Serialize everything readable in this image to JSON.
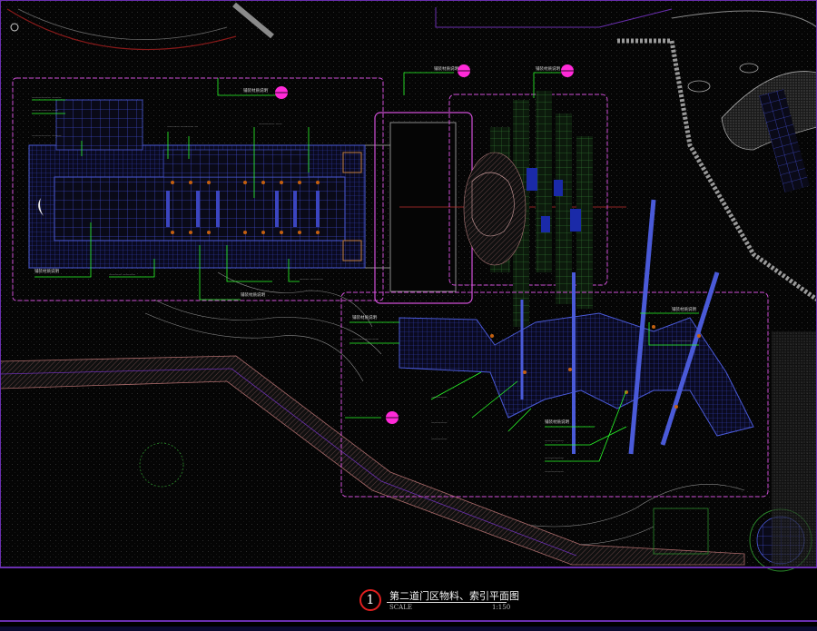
{
  "drawing": {
    "index_number": "1",
    "title": "第二道门区物料、索引平面图",
    "scale_label": "SCALE",
    "scale_value": "1:150"
  },
  "colors": {
    "background": "#000000",
    "frame": "#6a2fb0",
    "zone_outline": "#d04fd8",
    "leader": "#2aff2a",
    "grid": "#4a5ad8",
    "magenta_symbol": "#ff2ad8"
  },
  "annotations": [
    "铺装材质说明",
    "铺装材质说明",
    "铺装材质说明",
    "铺装材质说明",
    "铺装材质说明",
    "铺装材质说明",
    "铺装材质说明",
    "铺装材质说明"
  ]
}
